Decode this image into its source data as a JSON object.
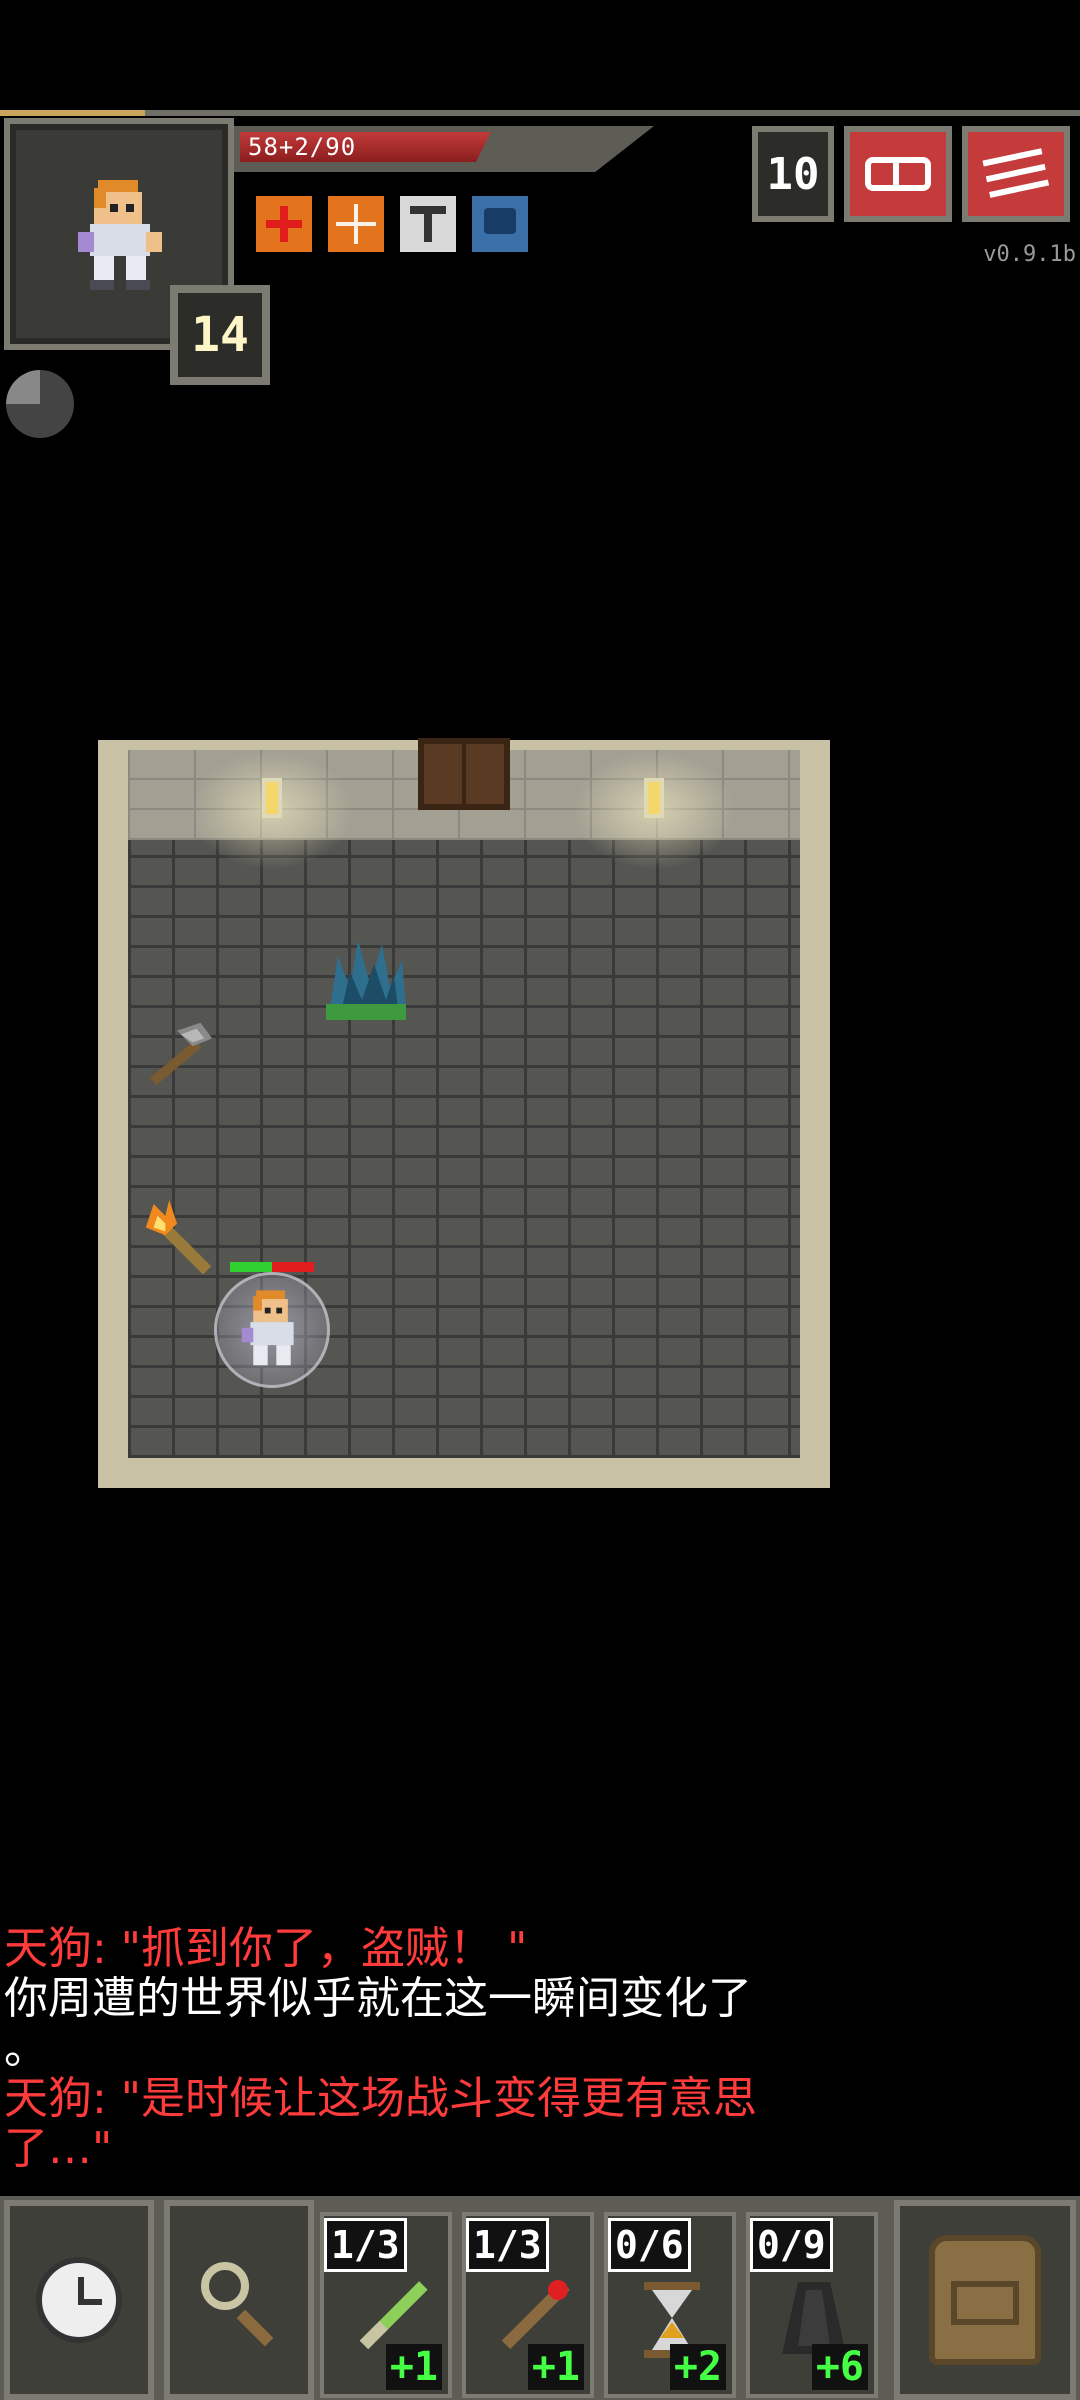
{
  "hud": {
    "hp_text": "58+2/90",
    "hp_fraction": 0.644,
    "level": "14",
    "depth": "10",
    "version": "v0.9.1b",
    "icons": {
      "journal": "journal-icon",
      "menu": "menu-icon",
      "buffs": [
        "bleeding-buff-icon",
        "shielded-buff-icon",
        "locked-floor-buff-icon",
        "barrier-buff-icon"
      ]
    }
  },
  "log": [
    {
      "text": "天狗: \"抓到你了，盗贼！ \"",
      "color": "#ff3b3b"
    },
    {
      "text": "你周遭的世界似乎就在这一瞬间变化了",
      "color": "#ffffff"
    },
    {
      "text": "。",
      "color": "#ffffff"
    },
    {
      "text": "天狗: \"是时候让这场战斗变得更有意思",
      "color": "#ff3b3b"
    },
    {
      "text": "了…\"",
      "color": "#ff3b3b"
    }
  ],
  "toolbar": {
    "wait_icon": "clock-icon",
    "search_icon": "magnifier-icon",
    "backpack_icon": "backpack-icon",
    "quickslots": [
      {
        "count": "1/3",
        "bonus": "+1",
        "item": "green-wand-icon"
      },
      {
        "count": "1/3",
        "bonus": "+1",
        "item": "fire-wand-icon"
      },
      {
        "count": "0/6",
        "bonus": "+2",
        "item": "hourglass-artifact-icon"
      },
      {
        "count": "0/9",
        "bonus": "+6",
        "item": "cloak-artifact-icon"
      }
    ]
  }
}
